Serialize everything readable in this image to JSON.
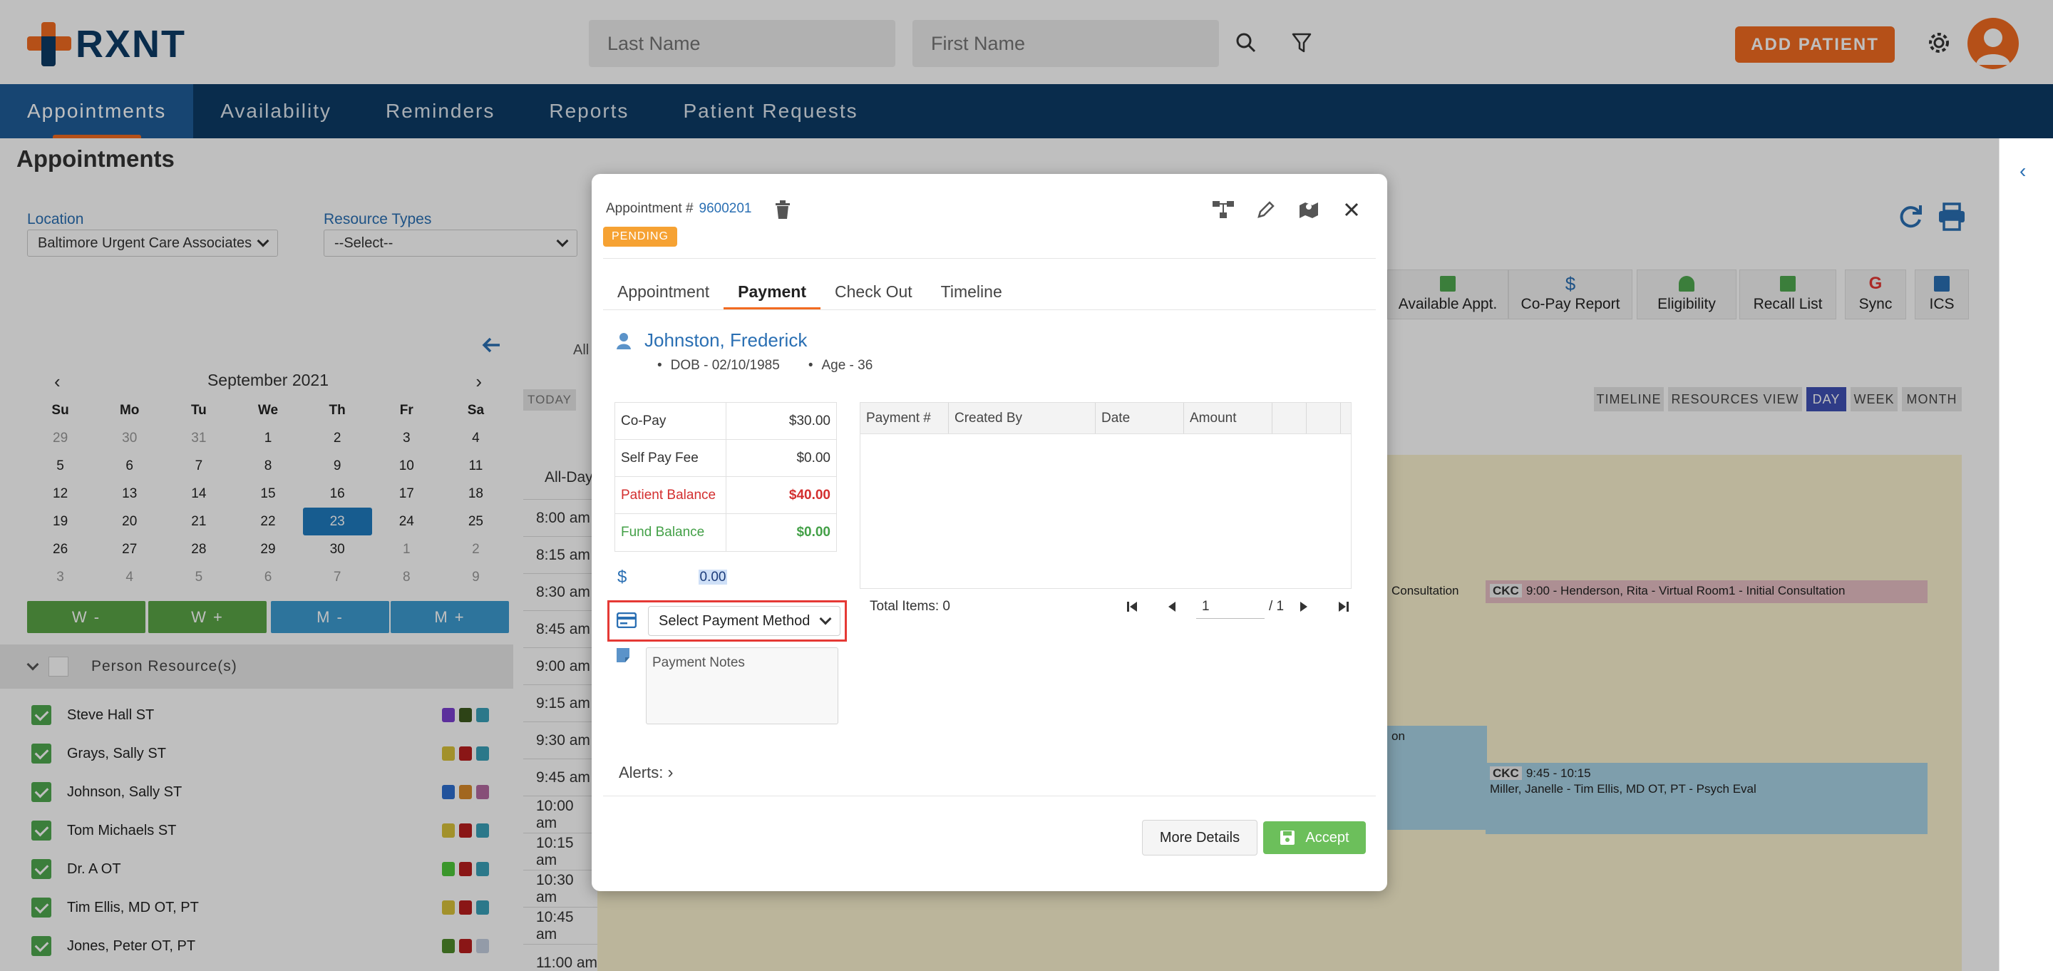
{
  "app": {
    "name": "RXNT"
  },
  "header": {
    "last_name_placeholder": "Last Name",
    "first_name_placeholder": "First Name",
    "add_patient_label": "ADD PATIENT",
    "icons": [
      "search-icon",
      "filter-icon",
      "gear-icon",
      "avatar"
    ]
  },
  "nav": {
    "items": [
      {
        "label": "Appointments",
        "active": true
      },
      {
        "label": "Availability"
      },
      {
        "label": "Reminders"
      },
      {
        "label": "Reports"
      },
      {
        "label": "Patient Requests"
      }
    ]
  },
  "page": {
    "title": "Appointments",
    "location_label": "Location",
    "location_value": "Baltimore Urgent Care Associates",
    "resource_types_label": "Resource Types",
    "resource_types_value": "--Select--",
    "all_label": "All",
    "today_label": "TODAY",
    "all_day_label": "All-Day"
  },
  "calendar": {
    "month_label": "September 2021",
    "dow": [
      "Su",
      "Mo",
      "Tu",
      "We",
      "Th",
      "Fr",
      "Sa"
    ],
    "weeks": [
      [
        "29",
        "30",
        "31",
        "1",
        "2",
        "3",
        "4"
      ],
      [
        "5",
        "6",
        "7",
        "8",
        "9",
        "10",
        "11"
      ],
      [
        "12",
        "13",
        "14",
        "15",
        "16",
        "17",
        "18"
      ],
      [
        "19",
        "20",
        "21",
        "22",
        "23",
        "24",
        "25"
      ],
      [
        "26",
        "27",
        "28",
        "29",
        "30",
        "1",
        "2"
      ],
      [
        "3",
        "4",
        "5",
        "6",
        "7",
        "8",
        "9"
      ]
    ],
    "selected_day": "23",
    "week_buttons": [
      "W -",
      "W +",
      "M -",
      "M +"
    ]
  },
  "resources": {
    "header": "Person Resource(s)",
    "items": [
      {
        "name": "Steve Hall ST",
        "swatches": [
          "#7b3fd1",
          "#3c5a1e",
          "#3aa0b8"
        ]
      },
      {
        "name": "Grays, Sally ST",
        "swatches": [
          "#d9c23a",
          "#b81e1e",
          "#3aa0b8"
        ]
      },
      {
        "name": "Johnson, Sally ST",
        "swatches": [
          "#2e6fd1",
          "#d98a2a",
          "#b46aa0"
        ]
      },
      {
        "name": "Tom Michaels ST",
        "swatches": [
          "#d9c23a",
          "#b81e1e",
          "#3aa0b8"
        ]
      },
      {
        "name": "Dr. A OT",
        "swatches": [
          "#4ec93a",
          "#b81e1e",
          "#3aa0b8"
        ]
      },
      {
        "name": "Tim Ellis, MD OT, PT",
        "swatches": [
          "#d9c23a",
          "#b81e1e",
          "#3aa0b8"
        ]
      },
      {
        "name": "Jones, Peter OT, PT",
        "swatches": [
          "#4e8a2a",
          "#b81e1e",
          "#c4cfe0"
        ]
      }
    ]
  },
  "toolbar": {
    "cards": [
      "Available Appt.",
      "Co-Pay Report",
      "Eligibility",
      "Recall List",
      "Sync",
      "ICS"
    ],
    "views": [
      "TIMELINE",
      "RESOURCES VIEW",
      "DAY",
      "WEEK",
      "MONTH"
    ],
    "active_view": "DAY"
  },
  "schedule": {
    "times": [
      "8:00 am",
      "8:15 am",
      "8:30 am",
      "8:45 am",
      "9:00 am",
      "9:15 am",
      "9:30 am",
      "9:45 am",
      "10:00 am",
      "10:15 am",
      "10:30 am",
      "10:45 am",
      "11:00 am"
    ],
    "appt1_tag": "CKC",
    "appt1_text": "9:00 - Henderson, Rita - Virtual Room1 - Initial Consultation",
    "appt1_left_fragment": "Consultation",
    "appt2_tag": "CKC",
    "appt2_time": "9:45 - 10:15",
    "appt2_text": "Miller, Janelle - Tim Ellis, MD OT, PT - Psych Eval",
    "appt3_fragment": "on"
  },
  "modal": {
    "appointment_label": "Appointment #",
    "appointment_number": "9600201",
    "status": "PENDING",
    "tabs": [
      "Appointment",
      "Payment",
      "Check Out",
      "Timeline"
    ],
    "active_tab": "Payment",
    "patient": {
      "name": "Johnston, Frederick",
      "dob": "DOB - 02/10/1985",
      "age": "Age - 36"
    },
    "fees": [
      {
        "label": "Co-Pay",
        "value": "$30.00",
        "style": "normal"
      },
      {
        "label": "Self Pay Fee",
        "value": "$0.00",
        "style": "normal"
      },
      {
        "label": "Patient Balance",
        "value": "$40.00",
        "style": "red"
      },
      {
        "label": "Fund Balance",
        "value": "$0.00",
        "style": "green"
      }
    ],
    "amount_symbol": "$",
    "amount_value": "0.00",
    "payment_method_value": "Select Payment Method",
    "payment_notes_placeholder": "Payment Notes",
    "alerts_label": "Alerts:",
    "payment_table_columns": [
      "Payment #",
      "Created By",
      "Date",
      "Amount",
      "",
      ""
    ],
    "total_items": "Total Items: 0",
    "pager_page": "1",
    "pager_total": "/ 1",
    "more_details_label": "More Details",
    "accept_label": "Accept"
  }
}
